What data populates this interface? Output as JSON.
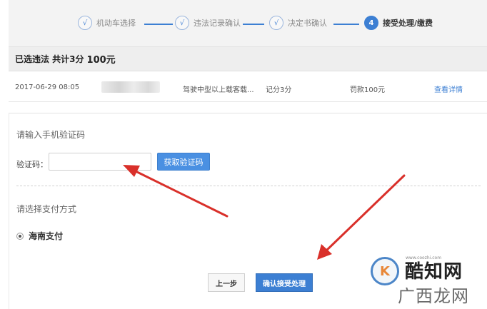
{
  "steps": [
    {
      "mark": "√",
      "label": "机动车选择"
    },
    {
      "mark": "√",
      "label": "违法记录确认"
    },
    {
      "mark": "√",
      "label": "决定书确认"
    },
    {
      "mark": "4",
      "label": "接受处理/缴费"
    }
  ],
  "summary": {
    "prefix": "已选违法 共计3分",
    "amount": "100元"
  },
  "record": {
    "datetime": "2017-06-29 08:05",
    "description": "驾驶中型以上载客载...",
    "points": "记分3分",
    "fine": "罚款100元",
    "detail_link": "查看详情"
  },
  "verify": {
    "title": "请输入手机验证码",
    "code_label": "验证码：",
    "code_value": "",
    "get_code_button": "获取验证码"
  },
  "payment": {
    "title": "请选择支付方式",
    "option": "海南支付"
  },
  "actions": {
    "prev": "上一步",
    "confirm": "确认接受处理"
  },
  "colors": {
    "accent": "#3c7fd3",
    "arrow": "#d9302a"
  },
  "watermark": {
    "logo_letter": "K",
    "name": "酷知网",
    "url": "www.coozhi.com",
    "sub": "广西龙网"
  }
}
